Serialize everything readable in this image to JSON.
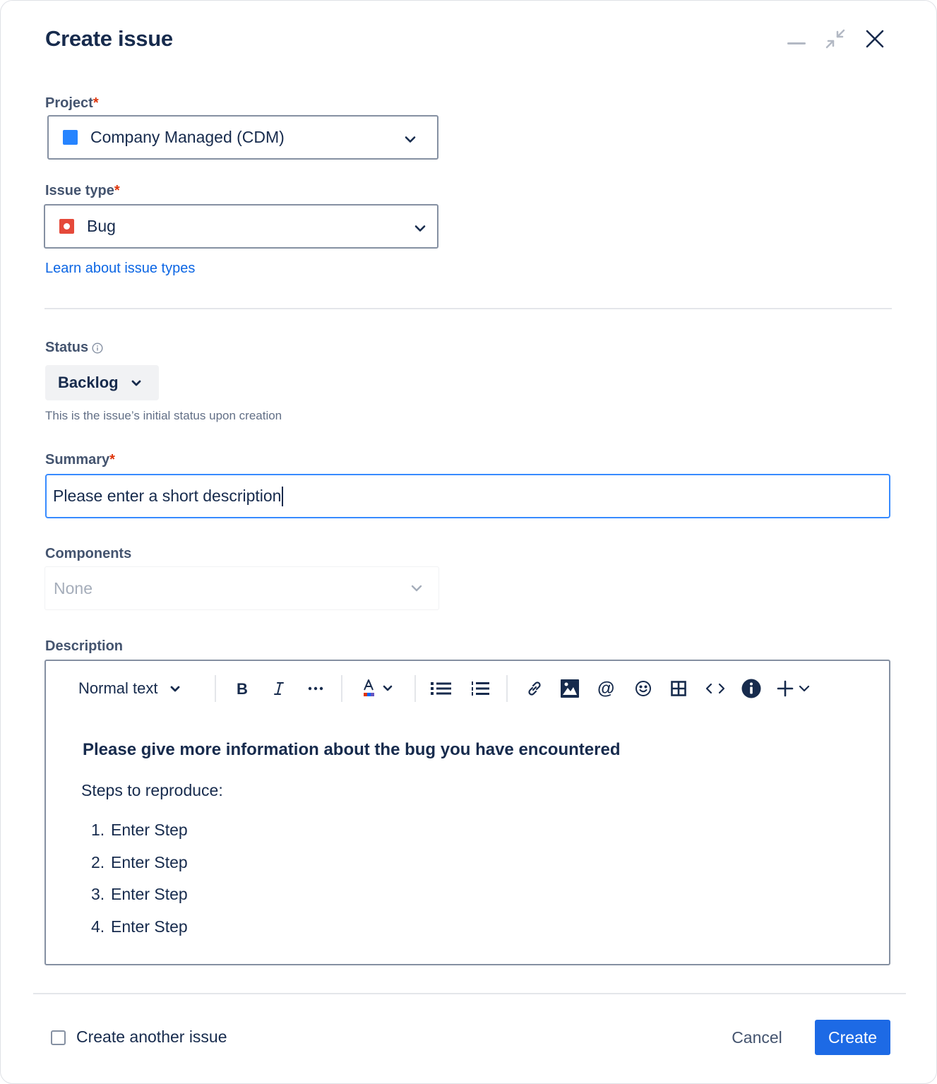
{
  "dialog": {
    "title": "Create issue"
  },
  "project": {
    "label": "Project",
    "required_mark": "*",
    "value": "Company Managed (CDM)",
    "icon": "square-icon",
    "icon_color": "#2684ff"
  },
  "issue_type": {
    "label": "Issue type",
    "required_mark": "*",
    "value": "Bug",
    "icon": "bug-icon",
    "icon_color": "#e5493a",
    "learn_link": "Learn about issue types"
  },
  "status": {
    "label": "Status",
    "value": "Backlog",
    "helper": "This is the issue’s initial status upon creation"
  },
  "summary": {
    "label": "Summary",
    "required_mark": "*",
    "value": "Please enter a short description"
  },
  "components": {
    "label": "Components",
    "value": "None"
  },
  "description": {
    "label": "Description",
    "toolbar": {
      "text_style": "Normal text"
    },
    "heading": "Please give more information about the bug you have encountered",
    "intro": "Steps to reproduce:",
    "steps": [
      {
        "num": "1.",
        "text": "Enter Step"
      },
      {
        "num": "2.",
        "text": "Enter Step"
      },
      {
        "num": "3.",
        "text": "Enter Step"
      },
      {
        "num": "4.",
        "text": "Enter Step"
      }
    ]
  },
  "footer": {
    "create_another": "Create another issue",
    "cancel": "Cancel",
    "create": "Create",
    "primary_color": "#1d6ae5"
  }
}
